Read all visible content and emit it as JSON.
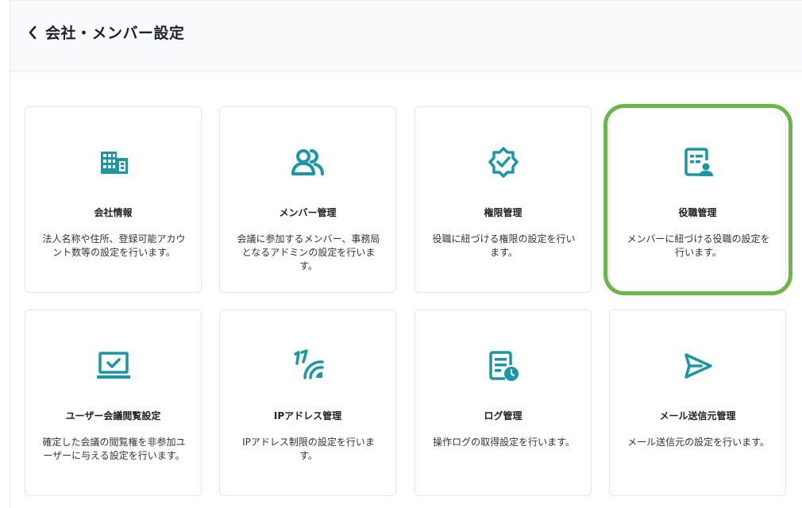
{
  "header": {
    "title": "会社・メンバー設定"
  },
  "colors": {
    "accent": "#1a97a6",
    "highlight": "#6bb54a"
  },
  "cards": [
    {
      "icon": "building-icon",
      "title": "会社情報",
      "description": "法人名称や住所、登録可能アカウント数等の設定を行います。"
    },
    {
      "icon": "members-icon",
      "title": "メンバー管理",
      "description": "会議に参加するメンバー、事務局となるアドミンの設定を行います。"
    },
    {
      "icon": "verified-badge-icon",
      "title": "権限管理",
      "description": "役職に紐づける権限の設定を行います。"
    },
    {
      "icon": "role-profile-icon",
      "title": "役職管理",
      "description": "メンバーに紐づける役職の設定を行います。"
    },
    {
      "icon": "monitor-check-icon",
      "title": "ユーザー会議閲覧設定",
      "description": "確定した会議の閲覧権を非参加ユーザーに与える設定を行います。"
    },
    {
      "icon": "ip-signal-icon",
      "title": "IPアドレス管理",
      "description": "IPアドレス制限の設定を行います。"
    },
    {
      "icon": "log-clock-icon",
      "title": "ログ管理",
      "description": "操作ログの取得設定を行います。"
    },
    {
      "icon": "send-icon",
      "title": "メール送信元管理",
      "description": "メール送信元の設定を行います。"
    }
  ]
}
